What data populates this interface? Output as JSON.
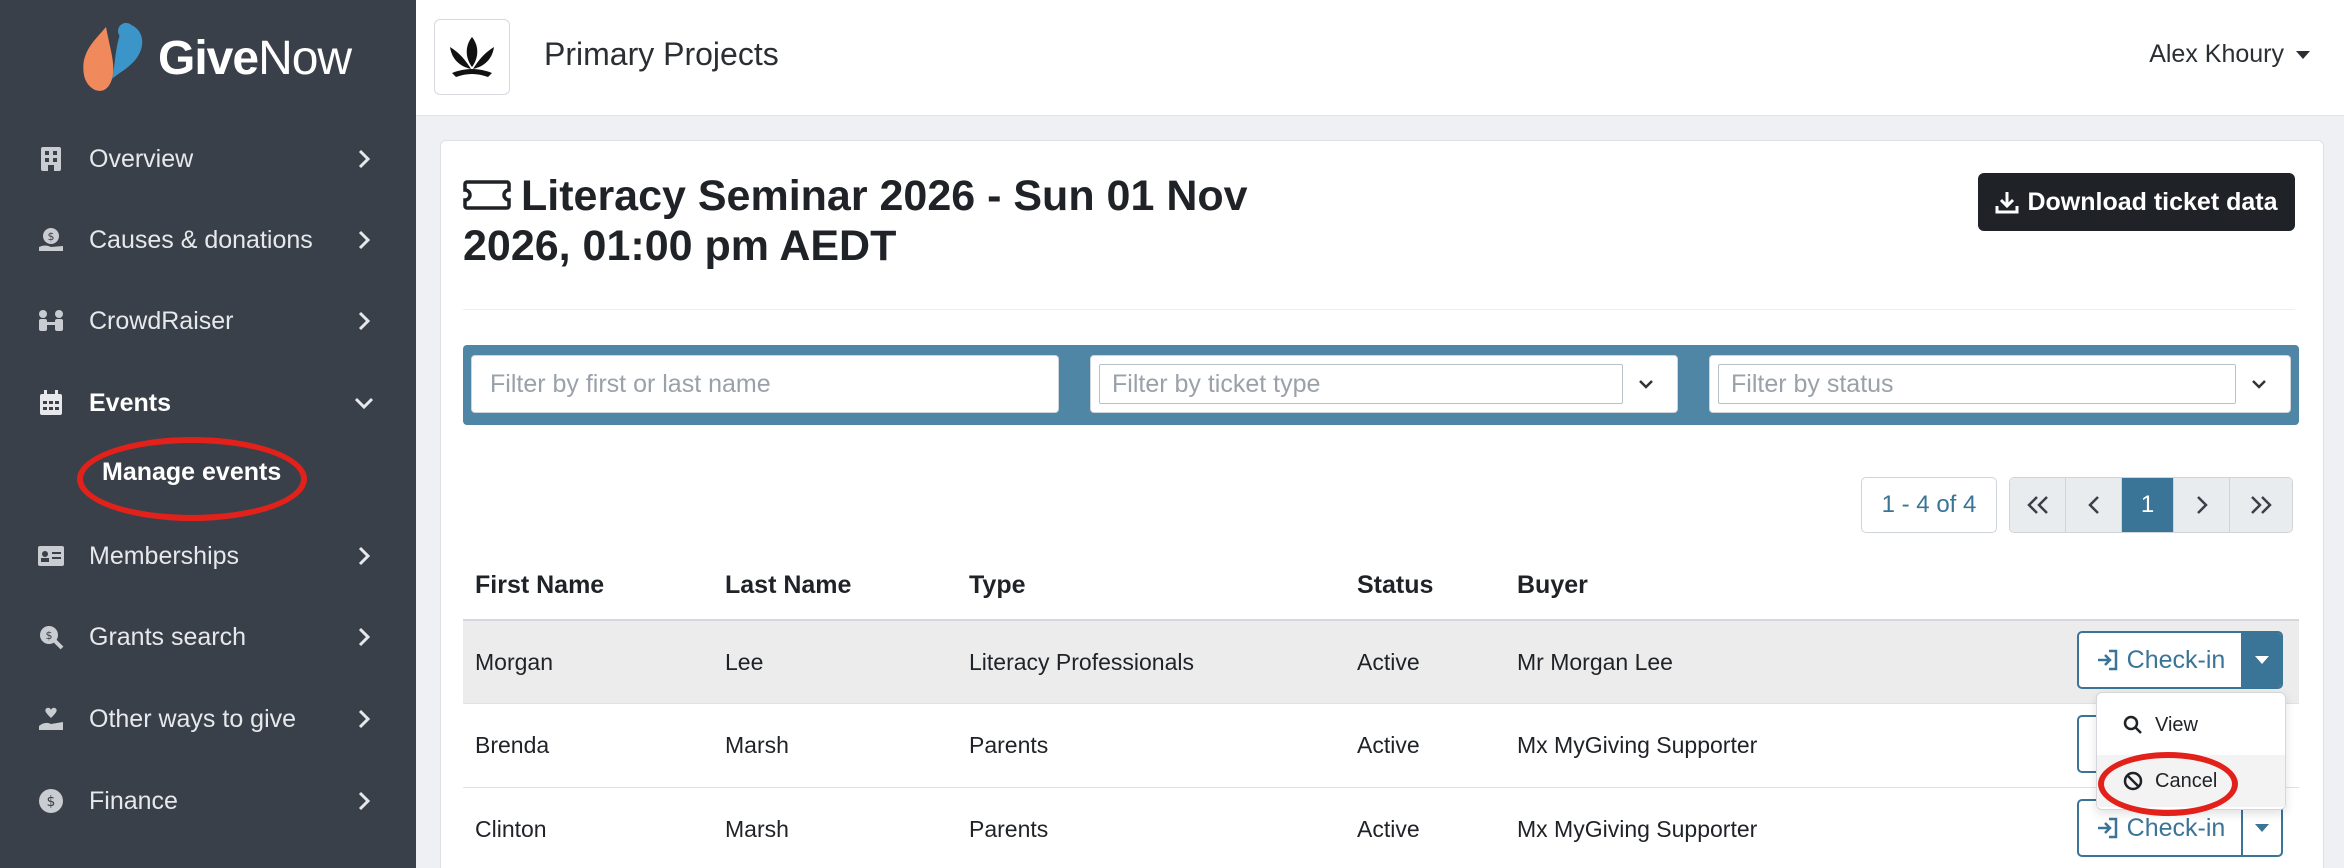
{
  "brand": {
    "name_bold": "Give",
    "name_light": "Now",
    "accent": "#e3211b",
    "sidebar_bg": "#3a4049",
    "primary": "#3a7496"
  },
  "sidebar": {
    "items": [
      {
        "label": "Overview",
        "icon": "building-icon"
      },
      {
        "label": "Causes & donations",
        "icon": "donation-icon"
      },
      {
        "label": "CrowdRaiser",
        "icon": "people-icon"
      },
      {
        "label": "Events",
        "icon": "calendar-icon",
        "expanded": true
      },
      {
        "label": "Memberships",
        "icon": "id-card-icon"
      },
      {
        "label": "Grants search",
        "icon": "search-dollar-icon"
      },
      {
        "label": "Other ways to give",
        "icon": "hand-heart-icon"
      },
      {
        "label": "Finance",
        "icon": "coin-icon"
      }
    ],
    "sub_item": "Manage events"
  },
  "header": {
    "org_name": "Primary Projects",
    "user_name": "Alex Khoury"
  },
  "page": {
    "title": "Literacy Seminar 2026 - Sun 01 Nov 2026, 01:00 pm AEDT",
    "download_label": "Download ticket data"
  },
  "filters": {
    "name_placeholder": "Filter by first or last name",
    "type_placeholder": "Filter by ticket type",
    "status_placeholder": "Filter by status"
  },
  "pagination": {
    "range": "1 - 4 of 4",
    "current_page": "1"
  },
  "table": {
    "columns": [
      "First Name",
      "Last Name",
      "Type",
      "Status",
      "Buyer"
    ],
    "rows": [
      {
        "first": "Morgan",
        "last": "Lee",
        "type": "Literacy Professionals",
        "status": "Active",
        "buyer": "Mr Morgan Lee"
      },
      {
        "first": "Brenda",
        "last": "Marsh",
        "type": "Parents",
        "status": "Active",
        "buyer": "Mx MyGiving Supporter"
      },
      {
        "first": "Clinton",
        "last": "Marsh",
        "type": "Parents",
        "status": "Active",
        "buyer": "Mx MyGiving Supporter"
      }
    ],
    "action_label": "Check-in"
  },
  "dropdown_menu": {
    "view_label": "View",
    "cancel_label": "Cancel"
  }
}
